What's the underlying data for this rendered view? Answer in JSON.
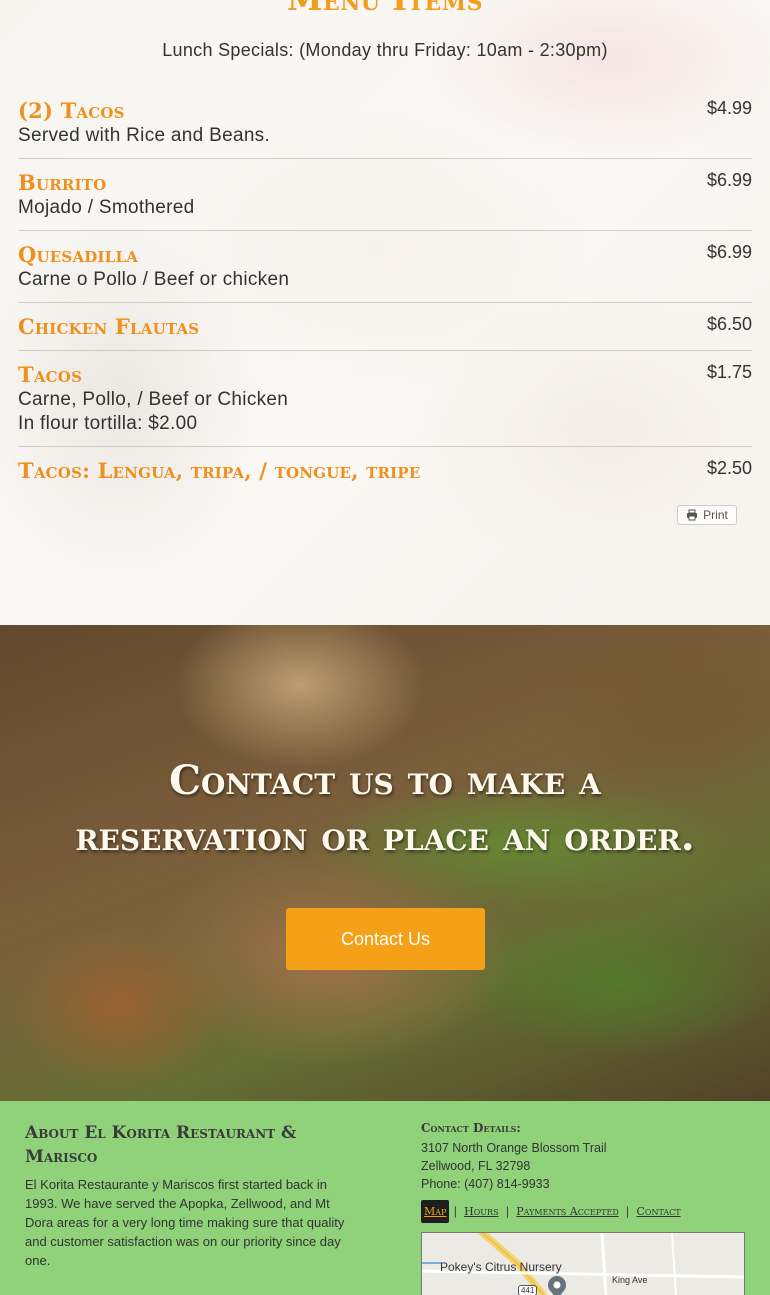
{
  "menu": {
    "heading": "Menu Items",
    "lunch_specials": "Lunch Specials: (Monday thru Friday: 10am - 2:30pm)",
    "items": [
      {
        "name": "(2) Tacos",
        "desc": [
          "Served with Rice and Beans."
        ],
        "price": "$4.99"
      },
      {
        "name": "Burrito",
        "desc": [
          "Mojado / Smothered"
        ],
        "price": "$6.99"
      },
      {
        "name": "Quesadilla",
        "desc": [
          "Carne o Pollo / Beef or chicken"
        ],
        "price": "$6.99"
      },
      {
        "name": "Chicken Flautas",
        "desc": [],
        "price": "$6.50"
      },
      {
        "name": "Tacos",
        "desc": [
          "Carne, Pollo, / Beef or Chicken",
          "In flour tortilla: $2.00"
        ],
        "price": "$1.75"
      },
      {
        "name": "Tacos: Lengua, tripa, / tongue, tripe",
        "desc": [],
        "price": "$2.50"
      }
    ],
    "print_label": "Print"
  },
  "cta": {
    "heading_line1": "Contact us to make a",
    "heading_line2": "reservation or place an order.",
    "button_label": "Contact Us"
  },
  "footer": {
    "about_title": "About El Korita Restaurant & Marisco",
    "about_text": "El Korita Restaurante y Mariscos first started back in 1993. We have served the Apopka, Zellwood, and Mt Dora areas for a very long time making sure that quality and customer satisfaction was on our priority since day one.",
    "contact_title": "Contact Details:",
    "address_line1": "3107 North Orange Blossom Trail",
    "address_line2": "Zellwood, FL 32798",
    "phone": "Phone: (407) 814-9933",
    "tabs": [
      "Map",
      "Hours",
      "Payments Accepted",
      "Contact"
    ],
    "map": {
      "place_label": "Pokey's Citrus Nursery",
      "road_label": "King Ave",
      "route_shield": "441"
    }
  },
  "colors": {
    "accent_orange": "#f5a117",
    "item_name_orange": "#ef8f1c",
    "footer_green": "#8fd27a"
  }
}
